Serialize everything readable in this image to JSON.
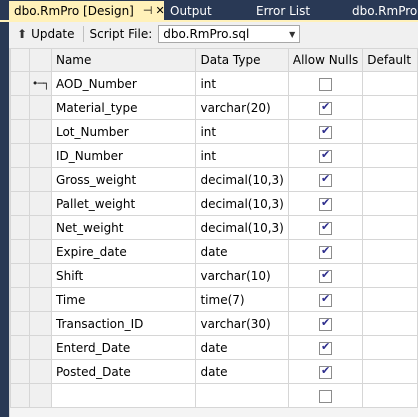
{
  "tabs": {
    "active": {
      "label": "dbo.RmPro [Design]",
      "pin": "⊣",
      "close": "✕"
    },
    "others": [
      "Output",
      "Error List",
      "dbo.RmPro"
    ]
  },
  "toolbar": {
    "update_label": "Update",
    "script_file_label": "Script File:",
    "script_file_value": "dbo.RmPro.sql"
  },
  "grid": {
    "headers": {
      "name": "Name",
      "data_type": "Data Type",
      "allow_nulls": "Allow Nulls",
      "default": "Default"
    },
    "rows": [
      {
        "name": "AOD_Number",
        "type": "int",
        "nulls": false,
        "key": true
      },
      {
        "name": "Material_type",
        "type": "varchar(20)",
        "nulls": true,
        "key": false
      },
      {
        "name": "Lot_Number",
        "type": "int",
        "nulls": true,
        "key": false
      },
      {
        "name": "ID_Number",
        "type": "int",
        "nulls": true,
        "key": false
      },
      {
        "name": "Gross_weight",
        "type": "decimal(10,3)",
        "nulls": true,
        "key": false
      },
      {
        "name": "Pallet_weight",
        "type": "decimal(10,3)",
        "nulls": true,
        "key": false
      },
      {
        "name": "Net_weight",
        "type": "decimal(10,3)",
        "nulls": true,
        "key": false
      },
      {
        "name": "Expire_date",
        "type": "date",
        "nulls": true,
        "key": false
      },
      {
        "name": "Shift",
        "type": "varchar(10)",
        "nulls": true,
        "key": false
      },
      {
        "name": "Time",
        "type": "time(7)",
        "nulls": true,
        "key": false
      },
      {
        "name": "Transaction_ID",
        "type": "varchar(30)",
        "nulls": true,
        "key": false
      },
      {
        "name": "Enterd_Date",
        "type": "date",
        "nulls": true,
        "key": false
      },
      {
        "name": "Posted_Date",
        "type": "date",
        "nulls": true,
        "key": false
      },
      {
        "name": "",
        "type": "",
        "nulls": false,
        "key": false
      }
    ]
  },
  "colors": {
    "chrome": "#293955",
    "active_tab": "#fff1b9",
    "panel": "#f0f0f0"
  },
  "icons": {
    "key": "primary-key-icon",
    "update": "update-arrow-icon",
    "dropdown": "chevron-down-icon"
  }
}
